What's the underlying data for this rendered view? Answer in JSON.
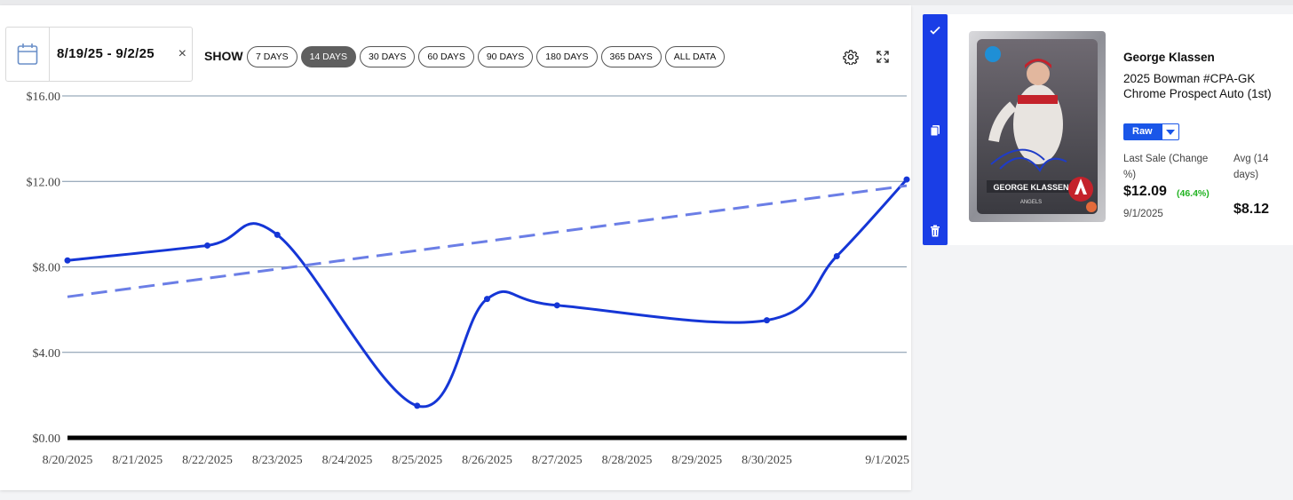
{
  "toolbar": {
    "date_range": "8/19/25 - 9/2/25",
    "clear_symbol": "×",
    "show_label": "SHOW",
    "ranges": [
      "7 DAYS",
      "14 DAYS",
      "30 DAYS",
      "60 DAYS",
      "90 DAYS",
      "180 DAYS",
      "365 DAYS",
      "ALL DATA"
    ],
    "active_range": "14 DAYS",
    "icons": [
      "calendar-icon",
      "settings-icon",
      "expand-icon"
    ]
  },
  "chart_data": {
    "type": "line",
    "x": [
      "8/20/2025",
      "8/21/2025",
      "8/22/2025",
      "8/23/2025",
      "8/24/2025",
      "8/25/2025",
      "8/26/2025",
      "8/27/2025",
      "8/28/2025",
      "8/29/2025",
      "8/30/2025",
      "8/31/2025",
      "9/1/2025"
    ],
    "x_tick_labels": [
      "8/20/2025",
      "8/21/2025",
      "8/22/2025",
      "8/23/2025",
      "8/24/2025",
      "8/25/2025",
      "8/26/2025",
      "8/27/2025",
      "8/28/2025",
      "8/29/2025",
      "8/30/2025",
      "9/1/2025"
    ],
    "y_tick_labels": [
      "$0.00",
      "$4.00",
      "$8.00",
      "$12.00",
      "$16.00"
    ],
    "ylim": [
      0,
      16
    ],
    "series": [
      {
        "points": [
          {
            "x": "8/20/2025",
            "y": 8.3
          },
          {
            "x": "8/22/2025",
            "y": 9.0
          },
          {
            "x": "8/23/2025",
            "y": 9.5
          },
          {
            "x": "8/25/2025",
            "y": 1.5
          },
          {
            "x": "8/26/2025",
            "y": 6.5
          },
          {
            "x": "8/27/2025",
            "y": 6.2
          },
          {
            "x": "8/30/2025",
            "y": 5.5
          },
          {
            "x": "8/31/2025",
            "y": 8.5
          },
          {
            "x": "9/1/2025",
            "y": 12.09
          }
        ],
        "color": "#1536d6"
      },
      {
        "points": [
          {
            "x": "8/20/2025",
            "y": 6.6
          },
          {
            "x": "9/1/2025",
            "y": 11.8
          }
        ],
        "color": "#6b7ee6",
        "dashed": true
      }
    ],
    "grid": true,
    "zero_line_color": "#000000"
  },
  "card": {
    "player_name": "George Klassen",
    "title": "2025 Bowman #CPA-GK Chrome Prospect Auto (1st)",
    "variant": "Raw",
    "last_sale_label": "Last Sale (Change %)",
    "last_sale_price": "$12.09",
    "last_sale_change": "(46.4%)",
    "last_sale_date": "9/1/2025",
    "avg_label": "Avg (14 days)",
    "avg_price": "$8.12",
    "image_text": {
      "player_name": "GEORGE KLASSEN",
      "team": "ANGELS"
    },
    "colors": {
      "accent": "#1a56e8",
      "change_positive": "#22b322"
    }
  },
  "side_actions": [
    "check-icon",
    "copy-icon",
    "trash-icon"
  ]
}
